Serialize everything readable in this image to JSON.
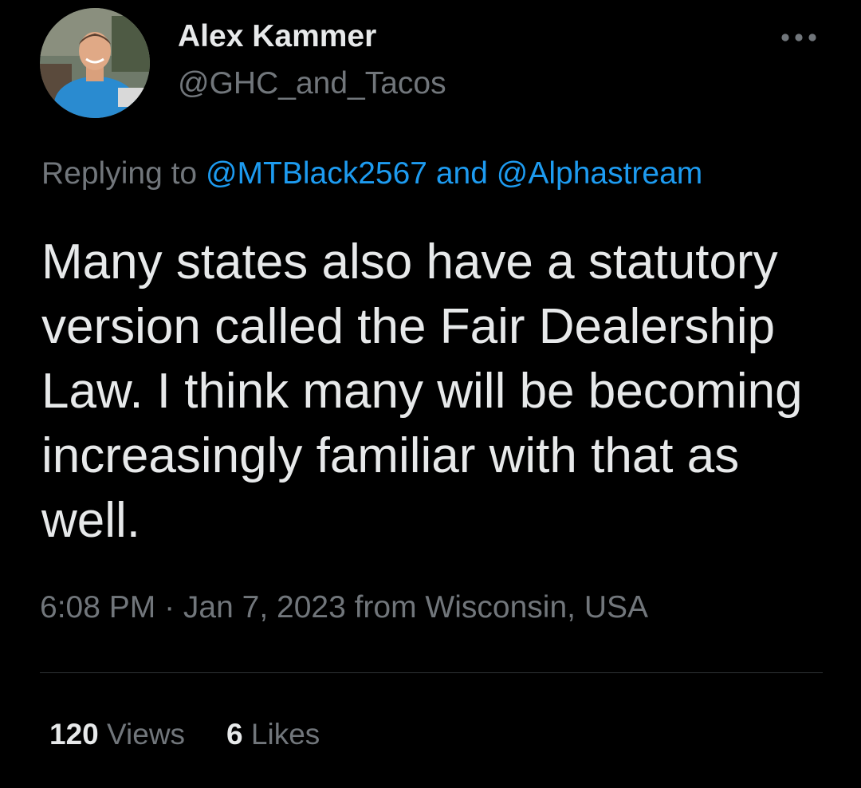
{
  "author": {
    "display_name": "Alex Kammer",
    "handle": "@GHC_and_Tacos",
    "avatar_icon": "profile-photo"
  },
  "more_icon": "ellipsis-icon",
  "reply": {
    "prefix": "Replying to ",
    "mention_1": "@MTBlack2567",
    "joiner": " and ",
    "mention_2": "@Alphastream"
  },
  "tweet": {
    "text": "Many states also have a statutory version called the Fair Dealership Law. I think many will be becoming increasingly familiar with that as well."
  },
  "meta": {
    "time": "6:08 PM",
    "separator": " · ",
    "date": "Jan 7, 2023",
    "location": " from Wisconsin, USA"
  },
  "stats": {
    "views_count": "120",
    "views_label": "Views",
    "likes_count": "6",
    "likes_label": "Likes"
  },
  "colors": {
    "background": "#000000",
    "text_primary": "#e7e9ea",
    "text_secondary": "#71767b",
    "accent": "#1d9bf0",
    "divider": "#2f3336"
  }
}
